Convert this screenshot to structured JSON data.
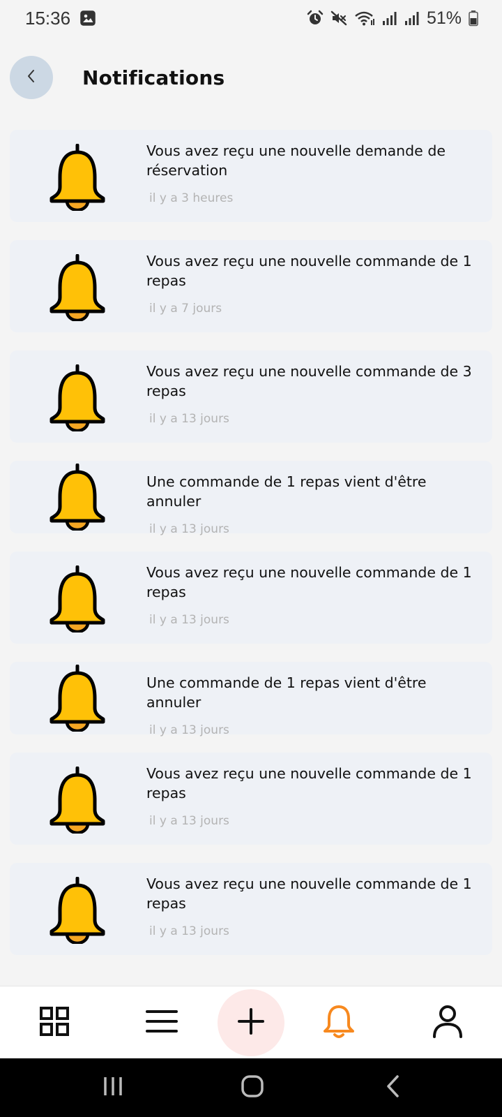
{
  "status_bar": {
    "time": "15:36",
    "battery": "51%",
    "icons": [
      "image-icon",
      "alarm-icon",
      "mute-icon",
      "wifi-icon",
      "signal-icon",
      "signal-icon",
      "battery-icon"
    ]
  },
  "header": {
    "title": "Notifications",
    "back_icon": "chevron-left-icon"
  },
  "notifications": [
    {
      "message": " Vous avez reçu une nouvelle demande de réservation",
      "time": "il y a 3 heures"
    },
    {
      "message": " Vous avez reçu une nouvelle commande de 1 repas",
      "time": "il y a 7 jours"
    },
    {
      "message": " Vous avez reçu une nouvelle commande de 3 repas",
      "time": "il y a 13 jours"
    },
    {
      "message": " Une commande de 1 repas vient d'être annuler",
      "time": "il y a 13 jours"
    },
    {
      "message": " Vous avez reçu une nouvelle commande de 1 repas",
      "time": "il y a 13 jours"
    },
    {
      "message": " Une commande de 1 repas vient d'être annuler",
      "time": "il y a 13 jours"
    },
    {
      "message": " Vous avez reçu une nouvelle commande de 1 repas",
      "time": "il y a 13 jours"
    },
    {
      "message": " Vous avez reçu une nouvelle commande de 1 repas",
      "time": "il y a 13 jours"
    }
  ],
  "bottom_nav": {
    "items": [
      {
        "icon": "grid-icon",
        "active": false
      },
      {
        "icon": "menu-icon",
        "active": false
      },
      {
        "icon": "plus-icon",
        "active": false
      },
      {
        "icon": "bell-icon",
        "active": true
      },
      {
        "icon": "user-icon",
        "active": false
      }
    ]
  },
  "colors": {
    "bell_fill": "#FFC107",
    "bell_clapper": "#F5A623",
    "active_nav": "#F7891F",
    "card_bg": "#EEF1F6",
    "back_btn_bg": "#CCD8E4",
    "add_btn_bg": "#FDE9E8"
  }
}
